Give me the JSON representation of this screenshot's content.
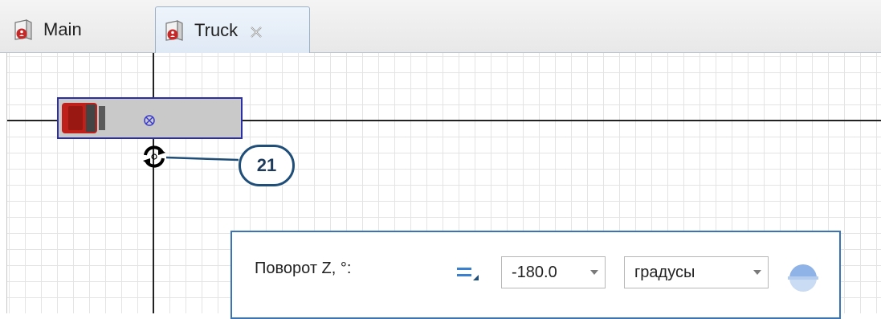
{
  "tabs": [
    {
      "label": "Main",
      "icon": "agent-icon",
      "active": false
    },
    {
      "label": "Truck",
      "icon": "agent-icon",
      "active": true,
      "closable": true
    }
  ],
  "canvas": {
    "origin_icon": "origin-crosshair-icon",
    "rotation_icon": "rotate-handle-icon",
    "callout_number": "21"
  },
  "properties": {
    "rotation_label": "Поворот Z, °:",
    "mode_icon": "static-value-icon",
    "angle_value": "-180.0",
    "units_value": "градусы",
    "sphere_icon": "half-sphere-icon"
  },
  "colors": {
    "selection": "#2a2fa6",
    "truck_body": "#c9c9c9",
    "truck_cab": "#c0201a",
    "callout_border": "#1f4e79",
    "panel_border": "#3a74b4",
    "mode_icon": "#3a80d0"
  }
}
